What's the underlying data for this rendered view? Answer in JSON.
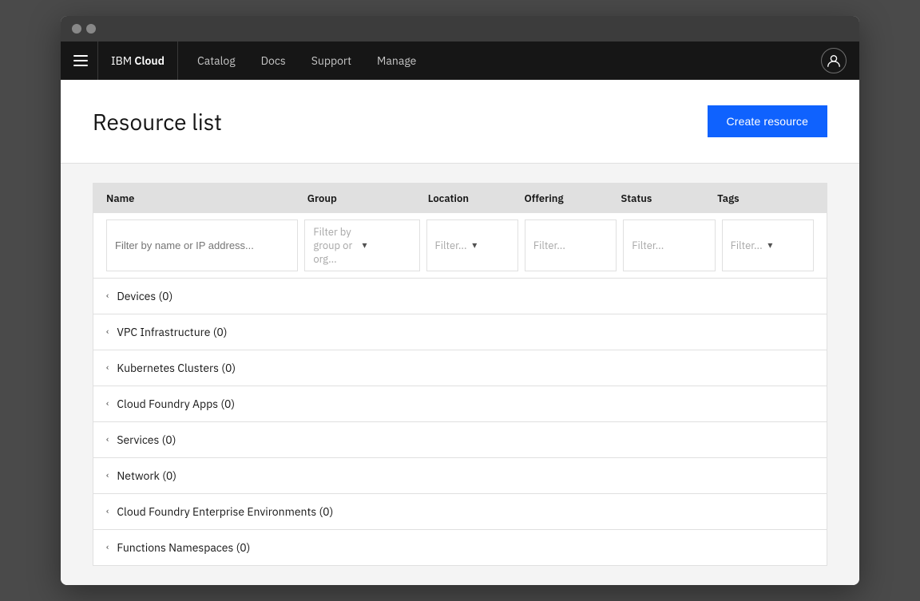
{
  "browser": {
    "dots": [
      "dot1",
      "dot2"
    ]
  },
  "navbar": {
    "hamburger_icon": "☰",
    "brand_normal": "IBM ",
    "brand_bold": "Cloud",
    "links": [
      {
        "label": "Catalog",
        "id": "catalog"
      },
      {
        "label": "Docs",
        "id": "docs"
      },
      {
        "label": "Support",
        "id": "support"
      },
      {
        "label": "Manage",
        "id": "manage"
      }
    ],
    "user_icon": "👤"
  },
  "page": {
    "title": "Resource list",
    "create_button": "Create resource"
  },
  "table": {
    "columns": [
      {
        "id": "name",
        "label": "Name"
      },
      {
        "id": "group",
        "label": "Group"
      },
      {
        "id": "location",
        "label": "Location"
      },
      {
        "id": "offering",
        "label": "Offering"
      },
      {
        "id": "status",
        "label": "Status"
      },
      {
        "id": "tags",
        "label": "Tags"
      }
    ],
    "filters": {
      "name_placeholder": "Filter by name or IP address...",
      "group_placeholder": "Filter by group or org...",
      "location_placeholder": "Filter...",
      "offering_placeholder": "Filter...",
      "status_placeholder": "Filter...",
      "tags_placeholder": "Filter..."
    },
    "categories": [
      {
        "id": "devices",
        "label": "Devices (0)"
      },
      {
        "id": "vpc",
        "label": "VPC Infrastructure (0)"
      },
      {
        "id": "kubernetes",
        "label": "Kubernetes Clusters (0)"
      },
      {
        "id": "cloudfoundry",
        "label": "Cloud Foundry Apps (0)"
      },
      {
        "id": "services",
        "label": "Services (0)"
      },
      {
        "id": "network",
        "label": "Network (0)"
      },
      {
        "id": "cfee",
        "label": "Cloud Foundry Enterprise Environments (0)"
      },
      {
        "id": "functions",
        "label": "Functions Namespaces (0)"
      }
    ]
  }
}
